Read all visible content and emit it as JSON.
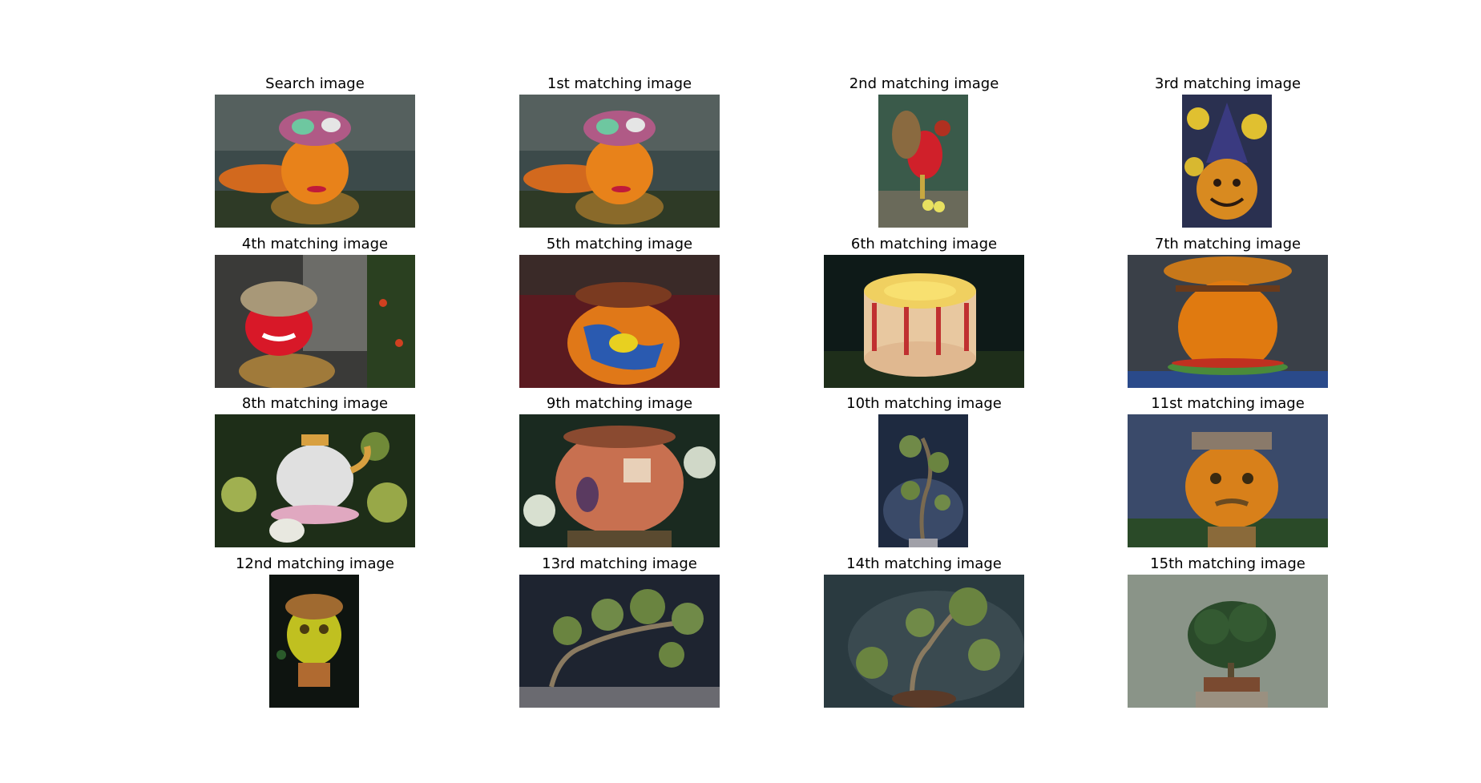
{
  "figure": {
    "panels": [
      {
        "caption": "Search image",
        "subject": "pumpkin with ribbon bow and painted face"
      },
      {
        "caption": "1st matching image",
        "subject": "pumpkin with ribbon bow and painted face"
      },
      {
        "caption": "2nd matching image",
        "subject": "rooster figure"
      },
      {
        "caption": "3rd matching image",
        "subject": "jack-o-lantern with witch hat"
      },
      {
        "caption": "4th matching image",
        "subject": "red pumpkin with straw hair"
      },
      {
        "caption": "5th matching image",
        "subject": "painted pumpkin with leaves"
      },
      {
        "caption": "6th matching image",
        "subject": "cake"
      },
      {
        "caption": "7th matching image",
        "subject": "pumpkin hamburger"
      },
      {
        "caption": "8th matching image",
        "subject": "teapot pumpkin"
      },
      {
        "caption": "9th matching image",
        "subject": "pumpkin house"
      },
      {
        "caption": "10th matching image",
        "subject": "bonsai tree"
      },
      {
        "caption": "11st matching image",
        "subject": "pumpkin with hat and mustache"
      },
      {
        "caption": "12nd matching image",
        "subject": "yellow pumpkin hut"
      },
      {
        "caption": "13rd matching image",
        "subject": "bonsai tree"
      },
      {
        "caption": "14th matching image",
        "subject": "bonsai tree"
      },
      {
        "caption": "15th matching image",
        "subject": "bonsai tree"
      }
    ]
  }
}
